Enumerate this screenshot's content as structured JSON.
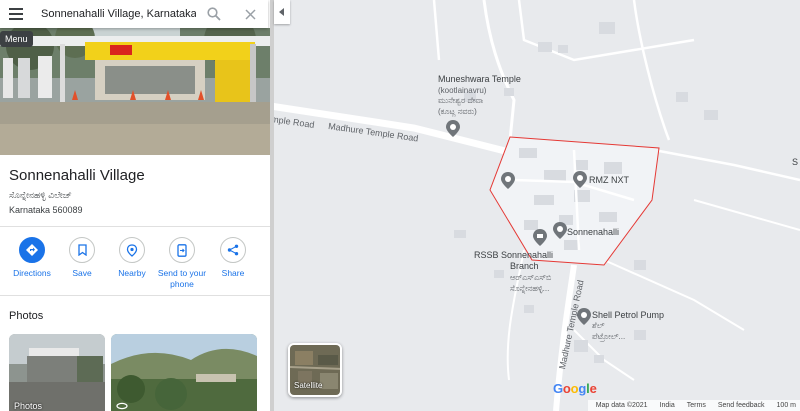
{
  "search": {
    "value": "Sonnenahalli Village, Karnataka",
    "menu_tooltip": "Menu"
  },
  "place": {
    "name": "Sonnenahalli Village",
    "local_name": "ಸೊನ್ನೇನಹಳ್ಳಿ ವಿಲೇಜ್",
    "address": "Karnataka 560089"
  },
  "actions": [
    {
      "label": "Directions",
      "icon": "directions-icon"
    },
    {
      "label": "Save",
      "icon": "bookmark-icon"
    },
    {
      "label": "Nearby",
      "icon": "nearby-icon"
    },
    {
      "label": "Send to your phone",
      "icon": "phone-icon"
    },
    {
      "label": "Share",
      "icon": "share-icon"
    }
  ],
  "photos": {
    "heading": "Photos",
    "items": [
      {
        "caption": "Photos"
      },
      {
        "caption": ""
      }
    ]
  },
  "map": {
    "labels": {
      "temple_name": "Muneshwara Temple",
      "temple_local": "(kootlainavru)",
      "temple_kn1": "ಮುನೇಶ್ವರ ದೇವಾ",
      "temple_kn2": "(ಕೂಟ್ಲ ನವರು)",
      "rmz": "RMZ NXT",
      "sonnenahalli": "Sonnenahalli",
      "rssb_1": "RSSB Sonnenahalli",
      "rssb_2": "Branch",
      "rssb_kn1": "ಆರ್‌ಎಸ್‌ಎಸ್‌ಬಿ",
      "rssb_kn2": "ಸೊನ್ನೇನಹಳ್ಳಿ...",
      "shell": "Shell Petrol Pump",
      "shell_kn1": "ಶೆಲ್",
      "shell_kn2": "ಪೆಟ್ರೋಲ್...",
      "road_temple_1": "mple Road",
      "road_temple_2": "Madhure Temple Road",
      "road_vertical": "Madhure Temple Road",
      "edge_s": "S"
    },
    "satellite_label": "Satellite",
    "logo": "Google",
    "attribution": [
      "Map data ©2021",
      "India",
      "Terms",
      "Send feedback",
      "100 m"
    ],
    "colors": {
      "boundary": "#e53935",
      "boundary_fill": "#f1f3f6",
      "road": "#ffffff",
      "background": "#e8eaed",
      "building": "#d8dbe0",
      "pin": "#70757a"
    }
  }
}
